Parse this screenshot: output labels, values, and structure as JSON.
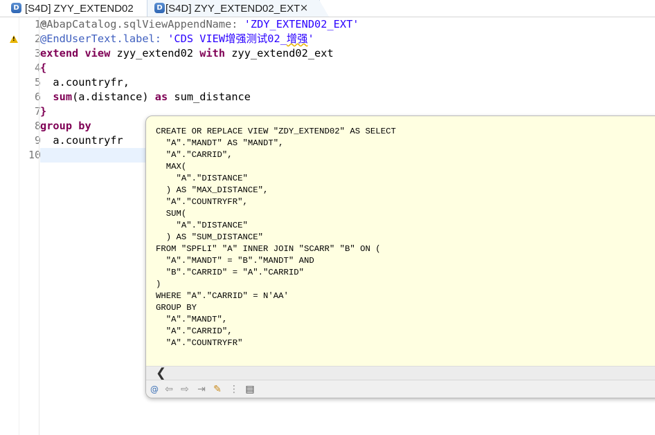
{
  "tabs": [
    {
      "label": "[S4D] ZYY_EXTEND02",
      "icon": "D"
    },
    {
      "label": "[S4D] ZYY_EXTEND02_EXT",
      "icon": "D",
      "active": true,
      "close": "×"
    }
  ],
  "gutter": {
    "line_numbers": [
      "1",
      "2",
      "3",
      "4",
      "5",
      "6",
      "7",
      "8",
      "9",
      "10"
    ],
    "fold_marker": "⊖"
  },
  "code": {
    "l1": {
      "anno": "@AbapCatalog.sqlViewAppendName: ",
      "str": "'ZDY_EXTEND02_EXT'"
    },
    "l2": {
      "anno": "@EndUserText.label: ",
      "str_a": "'CDS VIEW增强测试02_",
      "str_squig": "增强",
      "str_b": "'"
    },
    "l3": {
      "kw1": "extend view",
      "t1": " zyy_extend02 ",
      "kw2": "with",
      "t2": " zyy_extend02_ext"
    },
    "l4": {
      "t": "{"
    },
    "l5": {
      "t": "  a.countryfr,"
    },
    "l6": {
      "pre": "  ",
      "kw": "sum",
      "t1": "(a.distance) ",
      "kw2": "as",
      "t2": " sum_distance"
    },
    "l7": {
      "t": "}"
    },
    "l8": {
      "kw": "group by"
    },
    "l9": {
      "t": "  a.countryfr"
    }
  },
  "popup": {
    "sql": "CREATE OR REPLACE VIEW \"ZDY_EXTEND02\" AS SELECT\n  \"A\".\"MANDT\" AS \"MANDT\",\n  \"A\".\"CARRID\",\n  MAX(\n    \"A\".\"DISTANCE\"\n  ) AS \"MAX_DISTANCE\",\n  \"A\".\"COUNTRYFR\",\n  SUM(\n    \"A\".\"DISTANCE\"\n  ) AS \"SUM_DISTANCE\"\nFROM \"SPFLI\" \"A\" INNER JOIN \"SCARR\" \"B\" ON (\n  \"A\".\"MANDT\" = \"B\".\"MANDT\" AND\n  \"B\".\"CARRID\" = \"A\".\"CARRID\"\n)\nWHERE \"A\".\"CARRID\" = N'AA'\nGROUP BY\n  \"A\".\"MANDT\",\n  \"A\".\"CARRID\",\n  \"A\".\"COUNTRYFR\"",
    "scroll_left": "❮",
    "toolbar": {
      "at": "@",
      "back": "⇦",
      "forward": "⇨",
      "open": "⇥",
      "pin": "✎",
      "tree": "⋮",
      "outline": "▤"
    }
  },
  "colors": {
    "keyword": "#7f0055",
    "annotation": "#646464",
    "string": "#2a00ff",
    "popup_bg": "#ffffe1"
  }
}
